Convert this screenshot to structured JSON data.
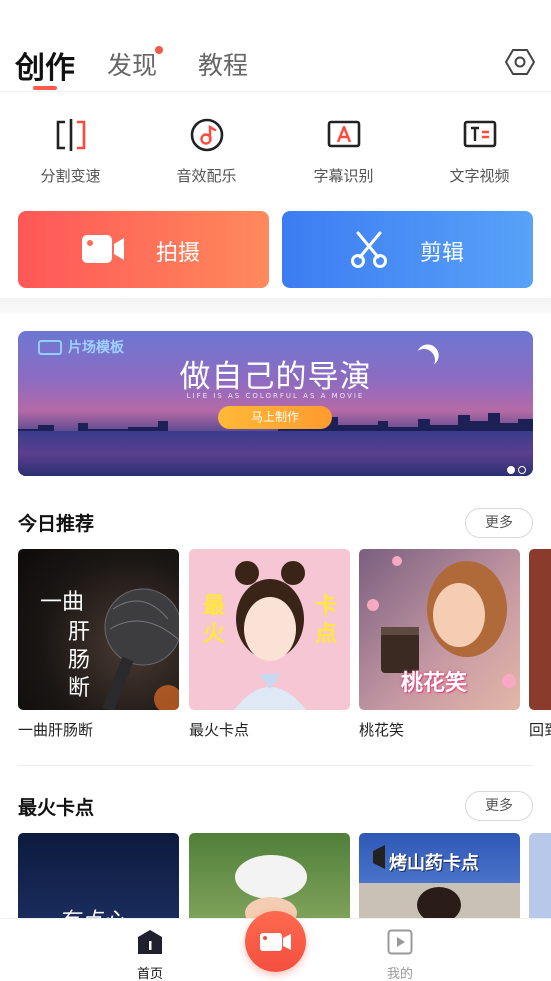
{
  "header": {
    "tabs": [
      {
        "label": "创作",
        "active": true
      },
      {
        "label": "发现",
        "has_badge": true
      },
      {
        "label": "教程"
      }
    ],
    "settings_icon": "settings-hexagon-icon"
  },
  "tools": [
    {
      "label": "分割变速",
      "icon": "split-speed-icon"
    },
    {
      "label": "音效配乐",
      "icon": "music-note-icon"
    },
    {
      "label": "字幕识别",
      "icon": "subtitle-recognize-icon"
    },
    {
      "label": "文字视频",
      "icon": "text-video-icon"
    }
  ],
  "actions": {
    "shoot_label": "拍摄",
    "edit_label": "剪辑"
  },
  "banner": {
    "tag": "片场模板",
    "title": "做自己的导演",
    "subtitle": "LIFE IS AS COLORFUL AS A MOVIE",
    "cta": "马上制作",
    "page_count": 2,
    "active_page": 1
  },
  "sections": [
    {
      "title": "今日推荐",
      "more": "更多",
      "items": [
        {
          "label": "一曲肝肠断",
          "art_text": [
            "一曲",
            "肝肠断"
          ]
        },
        {
          "label": "最火卡点",
          "art_text": [
            "最火",
            "卡点"
          ]
        },
        {
          "label": "桃花笑",
          "art_text": [
            "桃花笑"
          ]
        },
        {
          "label": "回到"
        }
      ]
    },
    {
      "title": "最火卡点",
      "more": "更多",
      "items": [
        {
          "art_text": [
            "有点心"
          ]
        },
        {},
        {
          "art_text": [
            "烤山药卡点"
          ]
        },
        {}
      ]
    }
  ],
  "bottom_nav": {
    "home_label": "首页",
    "mine_label": "我的",
    "accent": "#f0523f"
  }
}
